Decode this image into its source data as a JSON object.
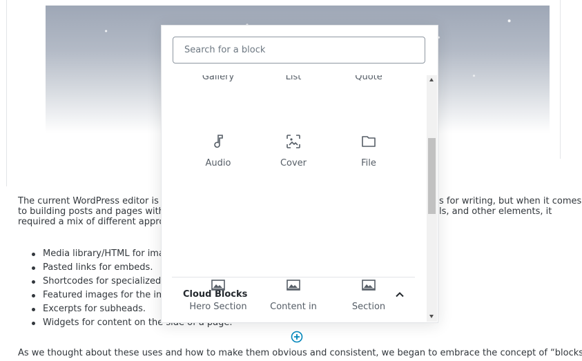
{
  "editor": {
    "paragraph1": {
      "line1_left": "The current WordPress editor is a",
      "line1_right": "s for writing, but when it comes",
      "line2_left": "to building posts and pages with",
      "line2_right": "ls, and other elements, it",
      "line3_left": "required a mix of different appro"
    },
    "bullets": [
      "Media library/HTML for ima",
      "Pasted links for embeds.",
      "Shortcodes for specialized",
      "Featured images for the im",
      "Excerpts for subheads.",
      "Widgets for content on the side of a page."
    ],
    "paragraph2": {
      "line1": "As we thought about these uses and how to make them obvious and consistent, we began to embrace the concept of “blocks.”"
    }
  },
  "inserter": {
    "search_placeholder": "Search for a block",
    "cut_labels": [
      "Gallery",
      "List",
      "Quote"
    ],
    "blocks": [
      {
        "label": "Audio",
        "icon": "music-note-icon"
      },
      {
        "label": "Cover",
        "icon": "cover-image-icon"
      },
      {
        "label": "File",
        "icon": "folder-icon"
      }
    ],
    "panel": {
      "title": "Cloud Blocks",
      "expanded": true,
      "blocks": [
        {
          "label": "Hero Section",
          "icon": "template-image-icon"
        },
        {
          "label": "Content in",
          "icon": "template-image-icon"
        },
        {
          "label": "Section",
          "icon": "template-image-icon"
        }
      ]
    }
  },
  "colors": {
    "accent": "#0085ba",
    "icon": "#555d66"
  }
}
